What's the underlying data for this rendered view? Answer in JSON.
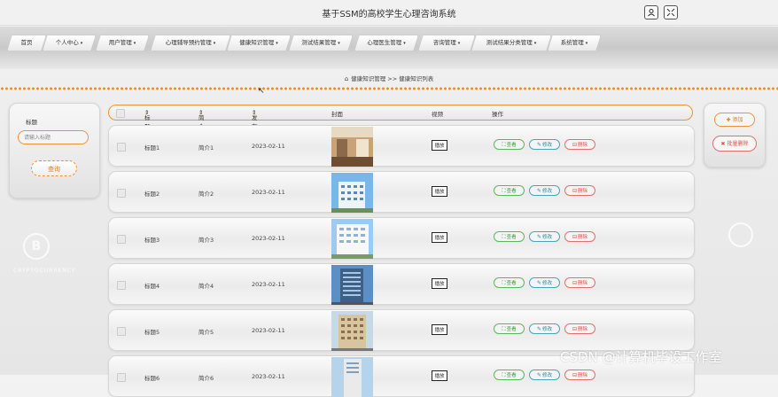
{
  "window": {
    "title": "基于SSM的高校学生心理咨询系统"
  },
  "nav": {
    "items": [
      {
        "label": "首页",
        "has_caret": false
      },
      {
        "label": "个人中心",
        "has_caret": true
      },
      {
        "label": "用户管理",
        "has_caret": true
      },
      {
        "label": "心理辅导预约管理",
        "has_caret": true
      },
      {
        "label": "健康知识管理",
        "has_caret": true
      },
      {
        "label": "测试结果管理",
        "has_caret": true
      },
      {
        "label": "心理医生管理",
        "has_caret": true
      },
      {
        "label": "咨询管理",
        "has_caret": true
      },
      {
        "label": "测试结果分类管理",
        "has_caret": true
      },
      {
        "label": "系统管理",
        "has_caret": true
      }
    ],
    "caret": "▾"
  },
  "breadcrumb": {
    "text": "健康知识管理 >> 健康知识列表"
  },
  "search": {
    "label": "标题",
    "placeholder": "请输入标题",
    "button": "查询"
  },
  "actions": {
    "add": "添加",
    "batch_delete": "批量删除"
  },
  "table": {
    "headers": {
      "title": "标题",
      "summary": "简介",
      "publish_time": "发布时间",
      "cover": "封面",
      "video": "视频",
      "ops": "操作"
    },
    "play_label": "播放",
    "view_label": "查看",
    "edit_label": "修改",
    "delete_label": "删除",
    "rows": [
      {
        "title": "标题1",
        "summary": "简介1",
        "date": "2023-02-11",
        "cover": "interior"
      },
      {
        "title": "标题2",
        "summary": "简介2",
        "date": "2023-02-11",
        "cover": "building-blue"
      },
      {
        "title": "标题3",
        "summary": "简介3",
        "date": "2023-02-11",
        "cover": "building-white"
      },
      {
        "title": "标题4",
        "summary": "简介4",
        "date": "2023-02-11",
        "cover": "building-dark"
      },
      {
        "title": "标题5",
        "summary": "简介5",
        "date": "2023-02-11",
        "cover": "building-beige"
      },
      {
        "title": "标题6",
        "summary": "简介6",
        "date": "2023-02-11",
        "cover": "building-tall"
      }
    ]
  },
  "decor": {
    "crypto_text": "CRYPTOCURRENCY",
    "coin_letter": "B"
  },
  "watermark": "CSDN @计算机毕设工作室",
  "colors": {
    "accent": "#f0913a",
    "view": "#5cb85c",
    "edit": "#4aa6b5",
    "delete": "#e36f6f"
  }
}
